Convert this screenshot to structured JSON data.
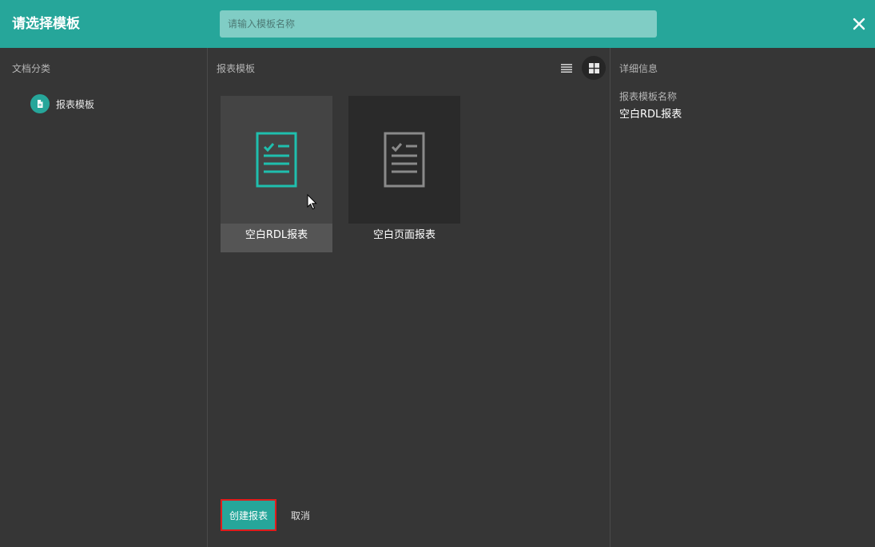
{
  "header": {
    "title": "请选择模板",
    "search_placeholder": "请输入模板名称"
  },
  "sidebar": {
    "section_label": "文档分类",
    "items": [
      {
        "label": "报表模板",
        "icon": "document-icon"
      }
    ]
  },
  "main": {
    "section_label": "报表模板",
    "view_modes": [
      "list",
      "grid"
    ],
    "active_view": "grid",
    "templates": [
      {
        "name": "空白RDL报表",
        "selected": true
      },
      {
        "name": "空白页面报表",
        "selected": false
      }
    ],
    "buttons": {
      "create": "创建报表",
      "cancel": "取消"
    }
  },
  "details": {
    "section_label": "详细信息",
    "name_label": "报表模板名称",
    "name_value": "空白RDL报表"
  },
  "colors": {
    "accent": "#26a69a",
    "highlight": "#e21b1b",
    "background": "#363636"
  }
}
